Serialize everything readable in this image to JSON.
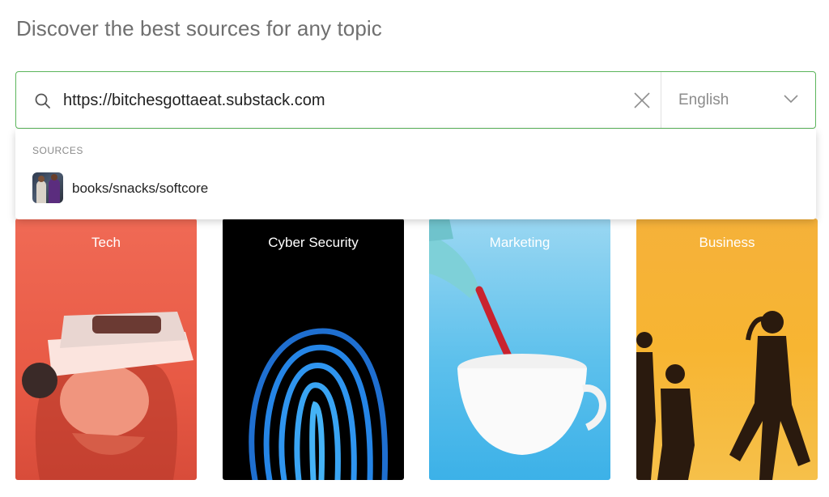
{
  "page": {
    "heading": "Discover the best sources for any topic"
  },
  "search": {
    "value": "https://bitchesgottaeat.substack.com",
    "language": "English"
  },
  "dropdown": {
    "heading": "SOURCES",
    "suggestions": [
      {
        "label": "books/snacks/softcore"
      }
    ]
  },
  "topics": [
    {
      "title": "Tech"
    },
    {
      "title": "Cyber Security"
    },
    {
      "title": "Marketing"
    },
    {
      "title": "Business"
    }
  ],
  "colors": {
    "accent_border": "#5bb55b",
    "tech": "#e85a45",
    "cyber": "#000000",
    "marketing": "#5cc0ec",
    "business": "#f7b532"
  }
}
